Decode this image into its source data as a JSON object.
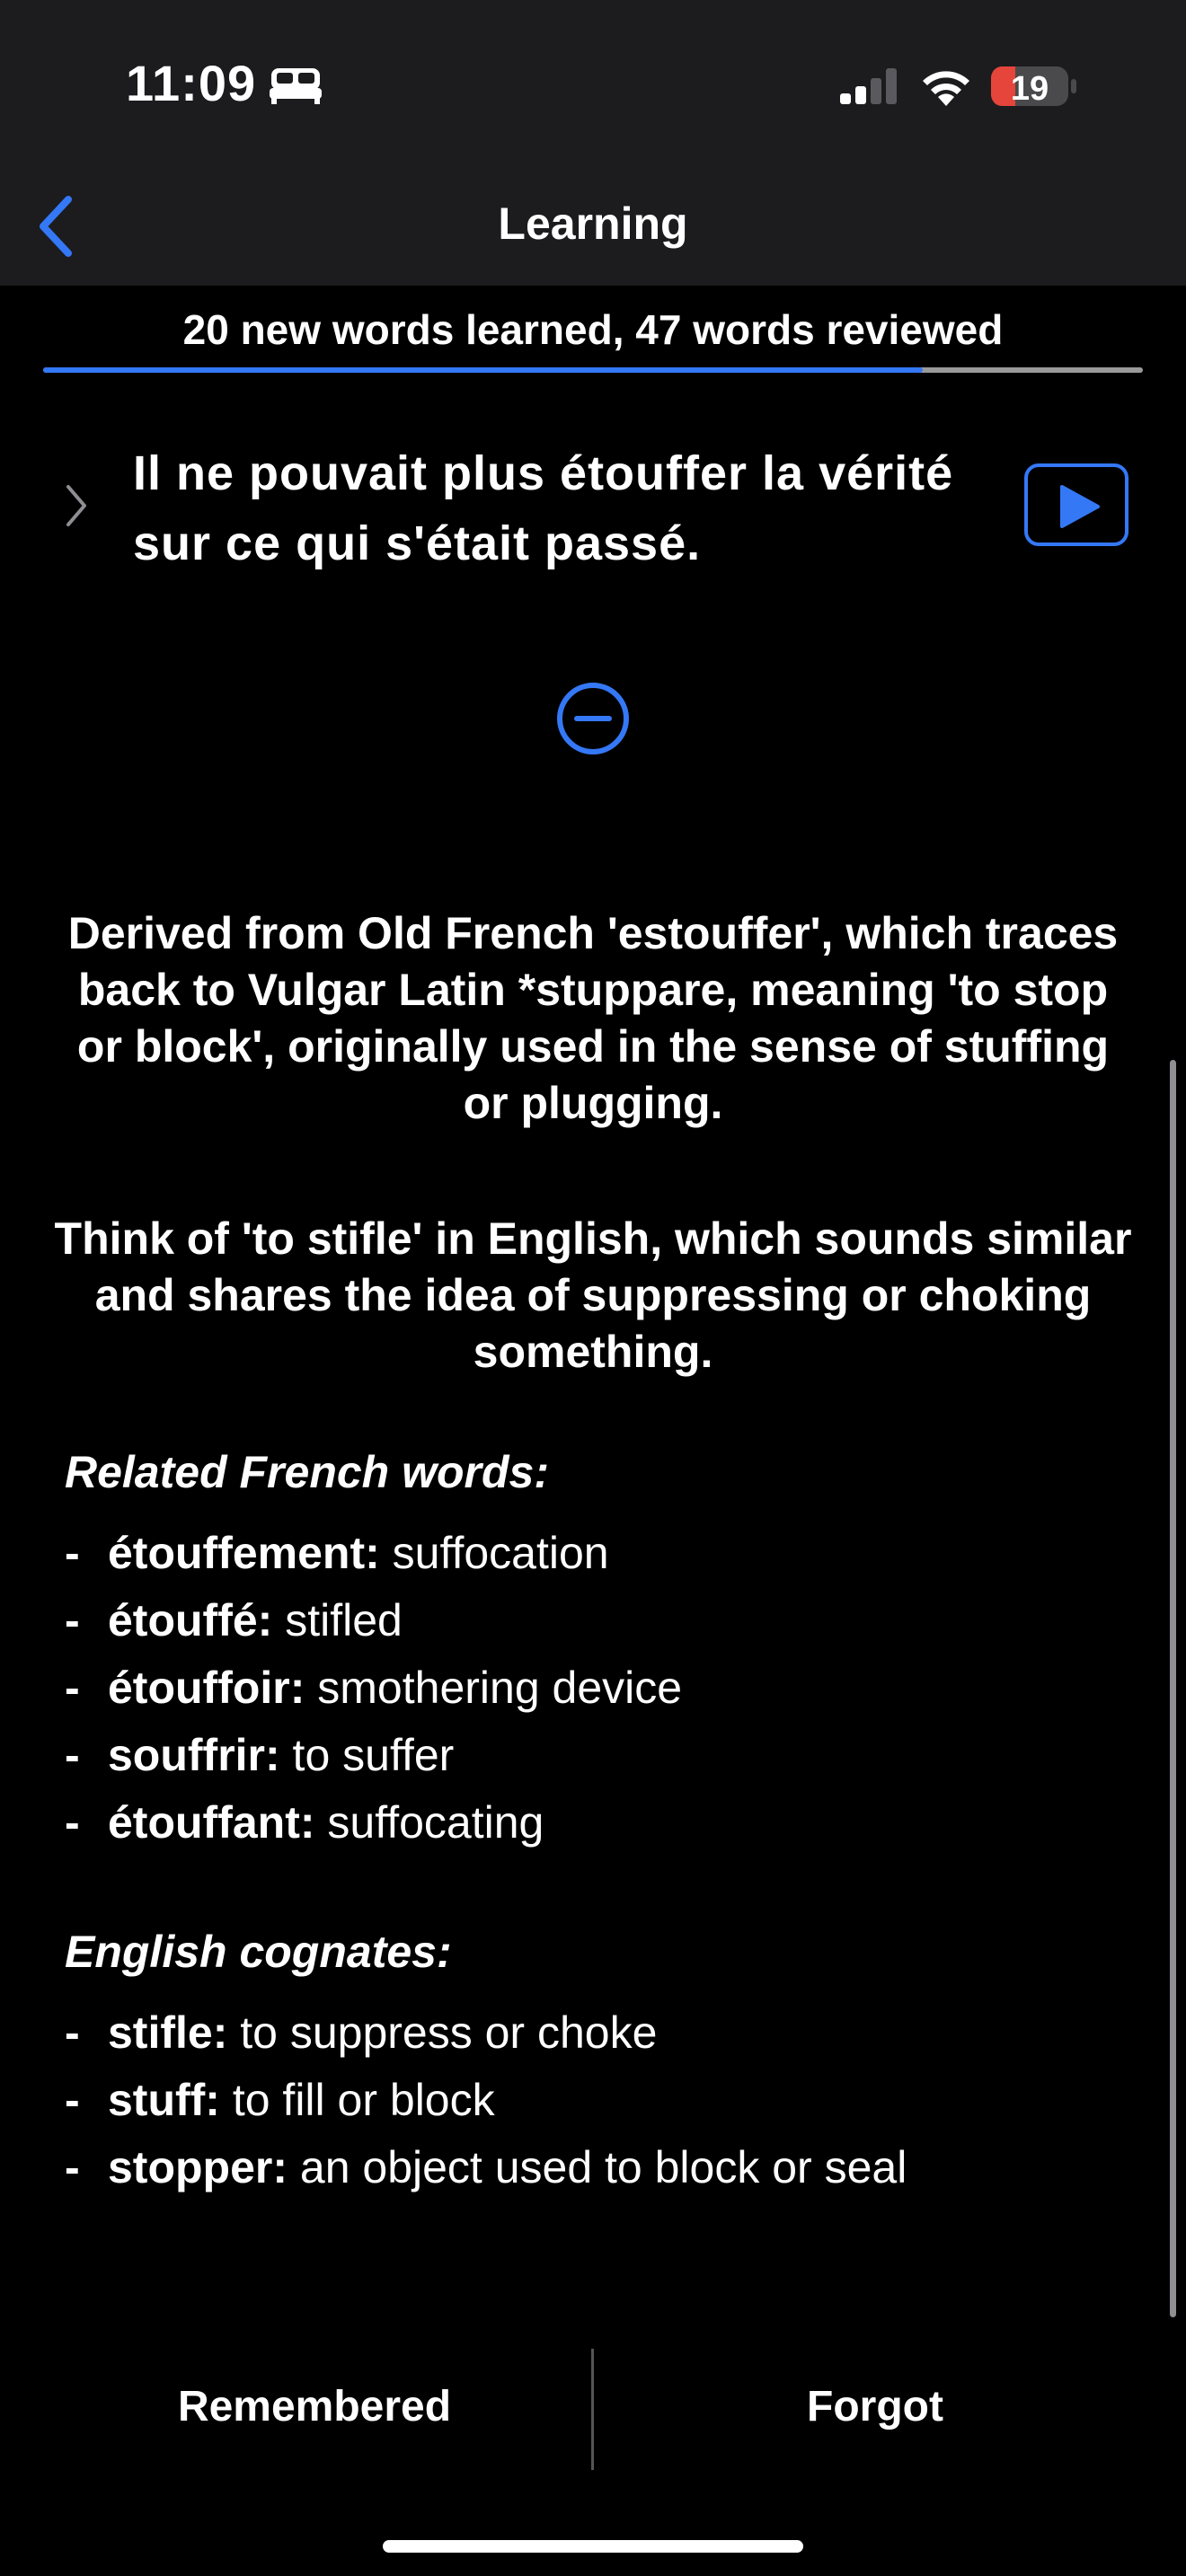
{
  "status_bar": {
    "time": "11:09",
    "battery": "19",
    "icons": [
      "bed-icon",
      "signal-icon",
      "wifi-icon",
      "battery-icon"
    ]
  },
  "nav": {
    "title": "Learning",
    "back_icon": "chevron-left-icon"
  },
  "progress": {
    "text": "20 new words learned, 47 words reviewed",
    "fraction": 0.8
  },
  "sentence": {
    "text": "Il ne pouvait plus étouffer la vérité sur ce qui s'était passé.",
    "expand_icon": "chevron-right-icon",
    "play_icon": "play-icon"
  },
  "collapse_icon": "minus-circle-icon",
  "etymology": "Derived from Old French 'estouffer', which traces back to Vulgar Latin *stuppare, meaning 'to stop or block', originally used in the sense of stuffing or plugging.",
  "mnemonic": "Think of 'to stifle' in English, which sounds similar and shares the idea of suppressing or choking something.",
  "related": {
    "title": "Related French words:",
    "items": [
      {
        "dash": "-",
        "term": "étouffement:",
        "def": " suffocation"
      },
      {
        "dash": "-",
        "term": "étouffé:",
        "def": " stifled"
      },
      {
        "dash": "-",
        "term": "étouffoir:",
        "def": " smothering device"
      },
      {
        "dash": "-",
        "term": "souffrir:",
        "def": " to suffer"
      },
      {
        "dash": "-",
        "term": "étouffant:",
        "def": " suffocating"
      }
    ]
  },
  "cognates": {
    "title": "English cognates:",
    "items": [
      {
        "dash": "-",
        "term": "stifle:",
        "def": " to suppress or choke"
      },
      {
        "dash": "-",
        "term": "stuff:",
        "def": " to fill or block"
      },
      {
        "dash": "-",
        "term": "stopper:",
        "def": " an object used to block or seal"
      }
    ]
  },
  "actions": {
    "remembered": "Remembered",
    "forgot": "Forgot"
  },
  "colors": {
    "accent": "#3478f6",
    "battery_low": "#e5453a",
    "background": "#000000",
    "bar": "#1c1c1e"
  }
}
